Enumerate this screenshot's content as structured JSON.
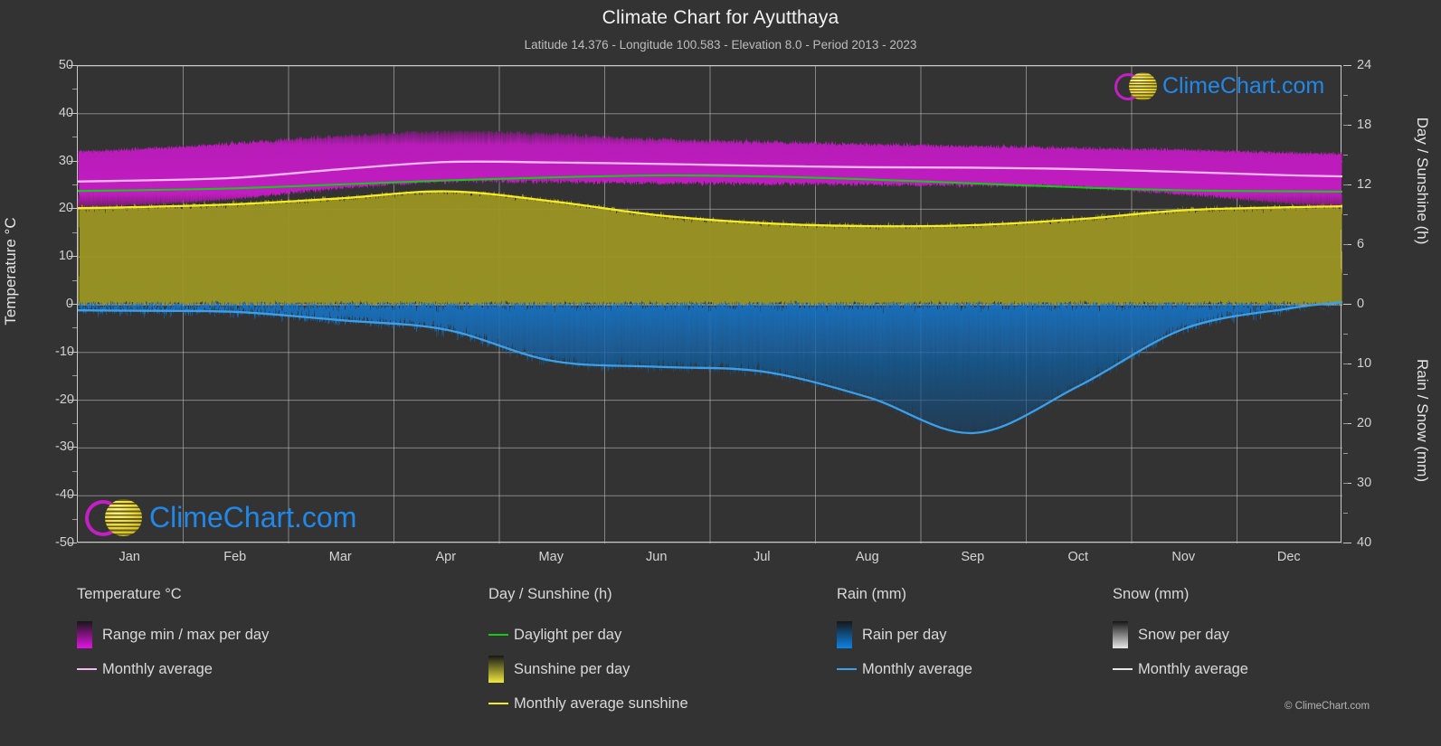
{
  "header": {
    "title": "Climate Chart for Ayutthaya",
    "subtitle": "Latitude 14.376 - Longitude 100.583 - Elevation 8.0 - Period 2013 - 2023"
  },
  "branding": {
    "logo_text": "ClimeChart.com",
    "copyright": "© ClimeChart.com"
  },
  "axes": {
    "left_title": "Temperature °C",
    "right_top_title": "Day / Sunshine (h)",
    "right_bottom_title": "Rain / Snow (mm)",
    "left_ticks": [
      "50",
      "40",
      "30",
      "20",
      "10",
      "0",
      "-10",
      "-20",
      "-30",
      "-40",
      "-50"
    ],
    "right_top_ticks": [
      "24",
      "18",
      "12",
      "6",
      "0"
    ],
    "right_bottom_ticks": [
      "0",
      "10",
      "20",
      "30",
      "40"
    ]
  },
  "legend": {
    "columns": [
      {
        "title": "Temperature °C",
        "items": [
          {
            "label": "Range min / max per day",
            "marker": "gradient-swatch",
            "color": "#e412e4"
          },
          {
            "label": "Monthly average",
            "marker": "line",
            "color": "#f5b8f0"
          }
        ]
      },
      {
        "title": "Day / Sunshine (h)",
        "items": [
          {
            "label": "Daylight per day",
            "marker": "line",
            "color": "#16c916"
          },
          {
            "label": "Sunshine per day",
            "marker": "gradient-swatch",
            "color": "#f0ea3c"
          },
          {
            "label": "Monthly average sunshine",
            "marker": "line",
            "color": "#f5ec24"
          }
        ]
      },
      {
        "title": "Rain (mm)",
        "items": [
          {
            "label": "Rain per day",
            "marker": "gradient-swatch",
            "color": "#0b84e8"
          },
          {
            "label": "Monthly average",
            "marker": "line",
            "color": "#3aa0ec"
          }
        ]
      },
      {
        "title": "Snow (mm)",
        "items": [
          {
            "label": "Snow per day",
            "marker": "gradient-swatch",
            "color": "#e8e8e8"
          },
          {
            "label": "Monthly average",
            "marker": "line",
            "color": "#e8e8e8"
          }
        ]
      }
    ]
  },
  "chart_data": {
    "type": "area",
    "title": "Climate Chart for Ayutthaya",
    "subtitle": "Latitude 14.376 - Longitude 100.583 - Elevation 8.0 - Period 2013 - 2023",
    "xlabel": "",
    "categories": [
      "Jan",
      "Feb",
      "Mar",
      "Apr",
      "May",
      "Jun",
      "Jul",
      "Aug",
      "Sep",
      "Oct",
      "Nov",
      "Dec"
    ],
    "axis_left": {
      "label": "Temperature °C",
      "min": -50,
      "max": 50,
      "step": 10,
      "grid": true
    },
    "axis_right_top": {
      "label": "Day / Sunshine (h)",
      "min": 0,
      "max": 24,
      "step": 6
    },
    "axis_right_bottom": {
      "label": "Rain / Snow (mm)",
      "min": 0,
      "max": 40,
      "step": 10,
      "inverted": true
    },
    "legend_position": "below",
    "series": [
      {
        "name": "Temperature monthly average",
        "unit": "°C",
        "color": "#f5b8f0",
        "render": "line",
        "values": [
          26.0,
          26.6,
          28.4,
          29.9,
          29.8,
          29.5,
          29.1,
          28.8,
          28.7,
          28.4,
          27.8,
          27.1
        ]
      },
      {
        "name": "Temperature range max per day",
        "unit": "°C",
        "color": "#cc1acc",
        "render": "band-top",
        "values": [
          32.5,
          33.8,
          35.3,
          36.3,
          35.7,
          34.6,
          34.1,
          33.6,
          33.2,
          32.8,
          32.4,
          31.8
        ]
      },
      {
        "name": "Temperature range min per day",
        "unit": "°C",
        "color": "#cc1acc",
        "render": "band-bottom",
        "values": [
          20.8,
          22.2,
          24.4,
          25.8,
          25.7,
          25.5,
          25.3,
          25.2,
          25.0,
          24.6,
          23.1,
          21.2
        ]
      },
      {
        "name": "Daylight per day",
        "unit": "h",
        "color": "#16c916",
        "render": "line",
        "values": [
          11.5,
          11.7,
          12.1,
          12.5,
          12.8,
          13.0,
          12.9,
          12.6,
          12.2,
          11.8,
          11.5,
          11.4
        ]
      },
      {
        "name": "Sunshine monthly average",
        "unit": "h",
        "color": "#f5ec24",
        "render": "line-area",
        "values": [
          9.8,
          10.1,
          10.7,
          11.4,
          10.4,
          9.0,
          8.2,
          7.9,
          8.0,
          8.6,
          9.5,
          9.8
        ]
      },
      {
        "name": "Rain monthly average",
        "unit": "mm",
        "color": "#3aa0ec",
        "render": "line-area-inverted",
        "values": [
          1.0,
          1.2,
          2.6,
          4.2,
          9.4,
          10.4,
          11.2,
          15.5,
          21.5,
          13.6,
          4.0,
          0.6
        ]
      },
      {
        "name": "Snow monthly average",
        "unit": "mm",
        "color": "#e8e8e8",
        "render": "line-area-inverted",
        "values": [
          0,
          0,
          0,
          0,
          0,
          0,
          0,
          0,
          0,
          0,
          0,
          0
        ]
      }
    ]
  }
}
